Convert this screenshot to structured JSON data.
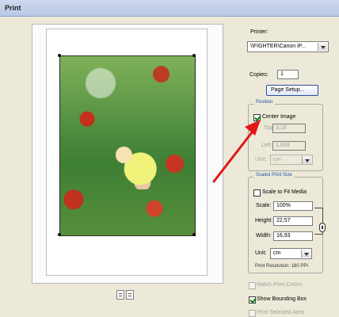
{
  "window": {
    "title": "Print"
  },
  "printer": {
    "label": "Printer:",
    "value": "\\\\FIGHTER\\Canon iP...",
    "copies_label": "Copies:",
    "copies_value": "1",
    "page_setup": "Page Setup..."
  },
  "position": {
    "title": "Position",
    "center_image_label": "Center Image",
    "center_image_checked": true,
    "top_label": "Top:",
    "top_value": "3,16",
    "left_label": "Left:",
    "left_value": "1,693",
    "unit_label": "Unit:",
    "unit_value": "cm"
  },
  "scaled_print_size": {
    "title": "Scaled Print Size",
    "scale_to_fit_label": "Scale to Fit Media",
    "scale_to_fit_checked": false,
    "scale_label": "Scale:",
    "scale_value": "100%",
    "height_label": "Height:",
    "height_value": "22,57",
    "width_label": "Width:",
    "width_value": "16,93",
    "unit_label": "Unit:",
    "unit_value": "cm",
    "print_resolution": "Print Resolution: 180 PPI"
  },
  "options": {
    "match_print_colors": {
      "label": "Match Print Colors",
      "checked": false,
      "disabled": true
    },
    "show_bounding_box": {
      "label": "Show Bounding Box",
      "checked": true,
      "disabled": false
    },
    "print_selected_area": {
      "label": "Print Selected Area",
      "checked": false,
      "disabled": true
    }
  },
  "icons": {
    "preview_tool_1": "print-preview-icon",
    "preview_tool_2": "page-icon",
    "annotation_arrow": "red-arrow-icon",
    "link_chain": "chain-link-icon"
  },
  "colors": {
    "background": "#ece9d8",
    "group_title": "#2350a8",
    "arrow": "#e01818"
  }
}
